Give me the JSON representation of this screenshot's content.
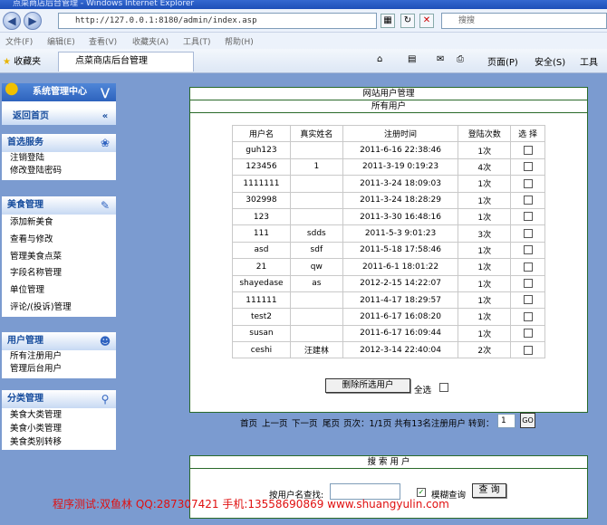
{
  "browser": {
    "title": "点菜商店后台管理 - Windows Internet Explorer",
    "address": "http://127.0.0.1:8180/admin/index.asp",
    "search_placeholder": "搜搜",
    "menu": [
      "文件(F)",
      "编辑(E)",
      "查看(V)",
      "收藏夹(A)",
      "工具(T)",
      "帮助(H)"
    ],
    "favorites": "收藏夹",
    "tab_title": "点菜商店后台管理",
    "commands": [
      "页面(P)",
      "安全(S)",
      "工具"
    ]
  },
  "sidebar": {
    "header": "系统管理中心",
    "home": "返回首页",
    "sections": [
      {
        "title": "首选服务",
        "items": [
          "注销登陆",
          "修改登陆密码"
        ]
      },
      {
        "title": "美食管理",
        "items": [
          "添加新美食",
          "查看与修改",
          "管理美食点菜",
          "字段名称管理",
          "单位管理",
          "评论/(投诉)管理"
        ]
      },
      {
        "title": "用户管理",
        "items": [
          "所有注册用户",
          "管理后台用户"
        ]
      },
      {
        "title": "分类管理",
        "items": [
          "美食大类管理",
          "美食小类管理",
          "美食类别转移"
        ]
      }
    ]
  },
  "main": {
    "title": "网站用户管理",
    "subtitle": "所有用户",
    "columns": [
      "用户名",
      "真实姓名",
      "注册时间",
      "登陆次数",
      "选 择"
    ],
    "rows": [
      [
        "guh123",
        "",
        "2011-6-16 22:38:46",
        "1次"
      ],
      [
        "123456",
        "1",
        "2011-3-19 0:19:23",
        "4次"
      ],
      [
        "1111111",
        "",
        "2011-3-24 18:09:03",
        "1次"
      ],
      [
        "302998",
        "",
        "2011-3-24 18:28:29",
        "1次"
      ],
      [
        "123",
        "",
        "2011-3-30 16:48:16",
        "1次"
      ],
      [
        "111",
        "sdds",
        "2011-5-3 9:01:23",
        "3次"
      ],
      [
        "asd",
        "sdf",
        "2011-5-18 17:58:46",
        "1次"
      ],
      [
        "21",
        "qw",
        "2011-6-1 18:01:22",
        "1次"
      ],
      [
        "shayedase",
        "as",
        "2012-2-15 14:22:07",
        "1次"
      ],
      [
        "111111",
        "",
        "2011-4-17 18:29:57",
        "1次"
      ],
      [
        "test2",
        "",
        "2011-6-17 16:08:20",
        "1次"
      ],
      [
        "susan",
        "",
        "2011-6-17 16:09:44",
        "1次"
      ],
      [
        "ceshi",
        "汪建林",
        "2012-3-14 22:40:04",
        "2次"
      ]
    ],
    "delete_button": "删除所选用户",
    "select_all": "全选",
    "pager": {
      "first": "首页",
      "prev": "上一页",
      "next": "下一页",
      "last": "尾页",
      "info": "页次：1/1页  共有13名注册用户  转到：",
      "page_value": "1",
      "go": "GO"
    }
  },
  "search": {
    "title": "搜 索 用 户",
    "label": "按用户名查找:",
    "fuzzy": "模糊查询",
    "button": "查 询"
  },
  "footer": "程序测试:双鱼林 QQ:287307421 手机:13558690869 www.shuangyulin.com"
}
